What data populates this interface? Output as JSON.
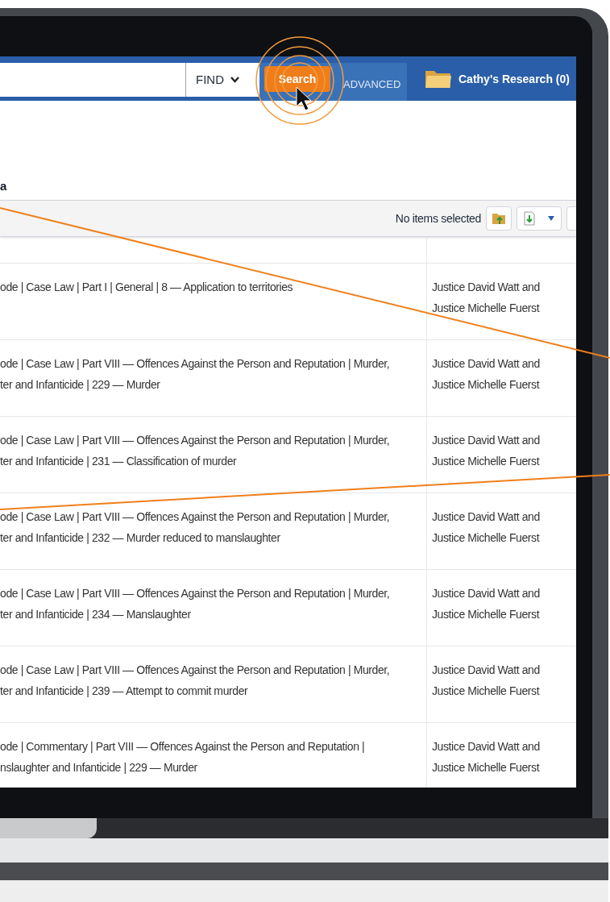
{
  "header": {
    "find_dropdown": "FIND",
    "search_button": "Search",
    "advanced_link": "ADVANCED",
    "research_folder": "Cathy's Research (0)"
  },
  "heading": "a",
  "toolbar": {
    "selection_status": "No items selected"
  },
  "table": {
    "rows": [
      {
        "title": "ode | Case Law | Part I | General | 8 — Application to territories",
        "author": "Justice David Watt and\nJustice Michelle Fuerst"
      },
      {
        "title": "ode | Case Law | Part VIII — Offences Against the Person and Reputation | Murder,\nter and Infanticide | 229 — Murder",
        "author": "Justice David Watt and\nJustice Michelle Fuerst"
      },
      {
        "title": "ode | Case Law | Part VIII — Offences Against the Person and Reputation | Murder,\nter and Infanticide | 231 — Classification of murder",
        "author": "Justice David Watt and\nJustice Michelle Fuerst"
      },
      {
        "title": "ode | Case Law | Part VIII — Offences Against the Person and Reputation | Murder,\nter and Infanticide | 232 — Murder reduced to manslaughter",
        "author": "Justice David Watt and\nJustice Michelle Fuerst"
      },
      {
        "title": "ode | Case Law | Part VIII — Offences Against the Person and Reputation | Murder,\nter and Infanticide | 234 — Manslaughter",
        "author": "Justice David Watt and\nJustice Michelle Fuerst"
      },
      {
        "title": "ode | Case Law | Part VIII — Offences Against the Person and Reputation | Murder,\nter and Infanticide | 239 — Attempt to commit murder",
        "author": "Justice David Watt and\nJustice Michelle Fuerst"
      },
      {
        "title": "ode | Commentary | Part VIII — Offences Against the Person and Reputation |\nnslaughter and Infanticide | 229 — Murder",
        "author": "Justice David Watt and\nJustice Michelle Fuerst"
      }
    ]
  }
}
